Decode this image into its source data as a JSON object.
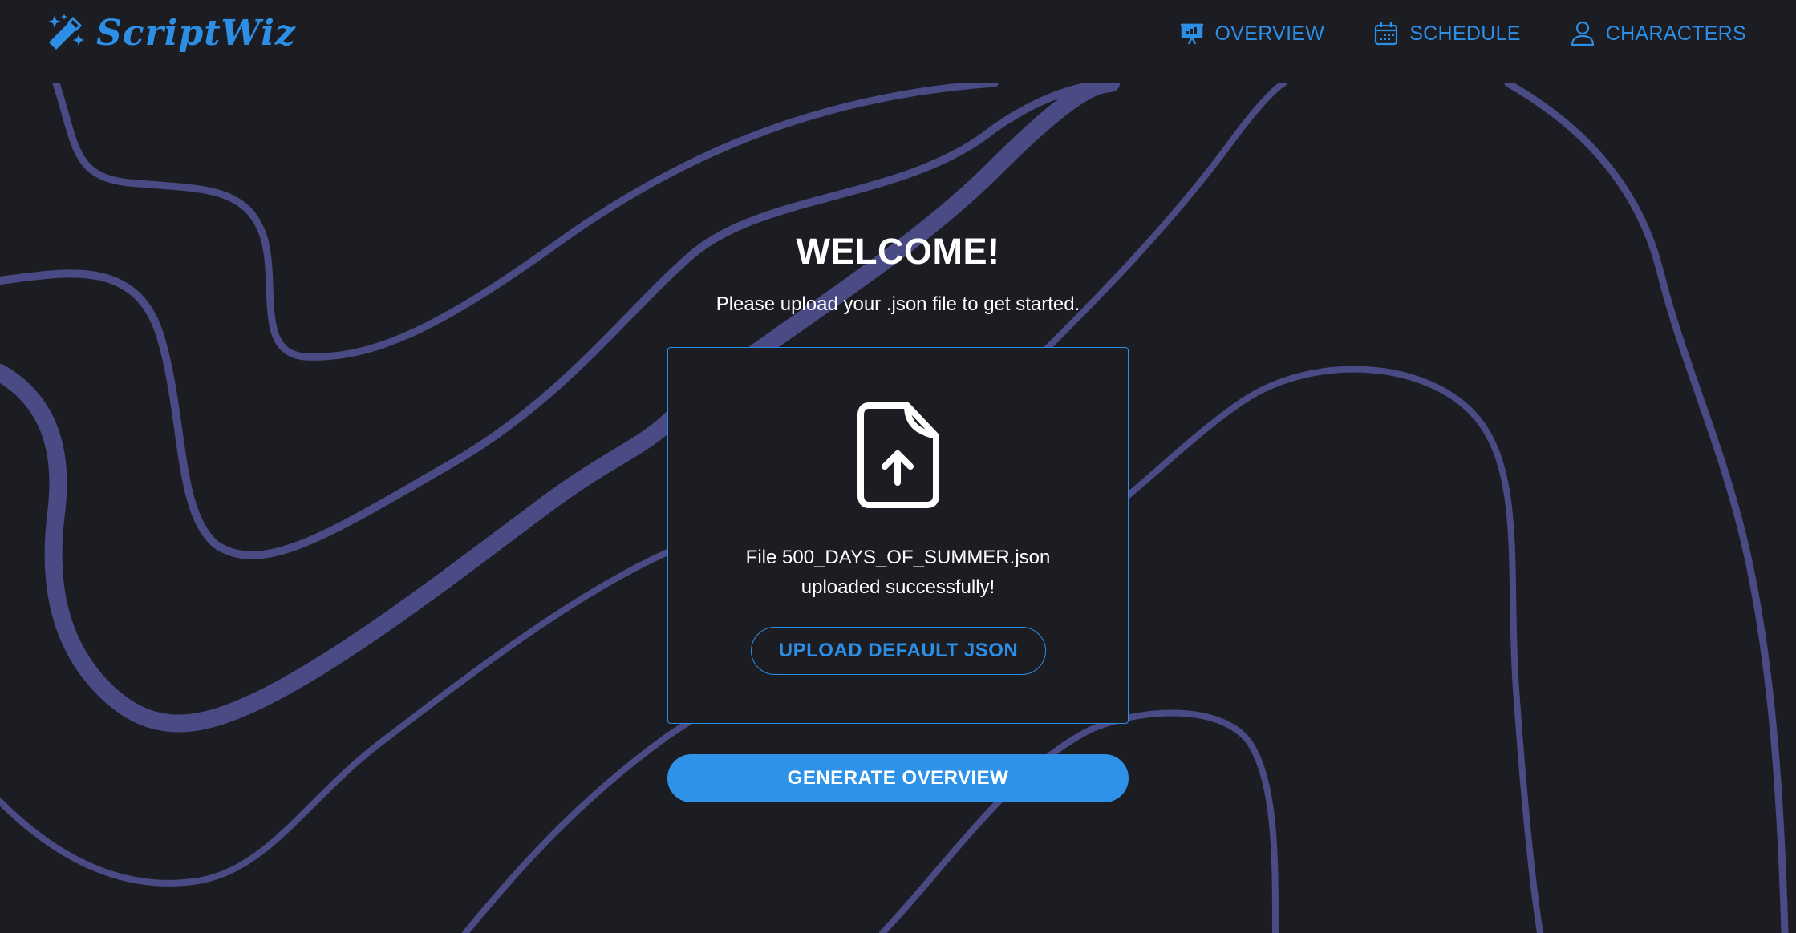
{
  "brand": {
    "name": "ScriptWiz",
    "icon": "magic-wand-icon"
  },
  "nav": {
    "items": [
      {
        "label": "OVERVIEW",
        "icon": "presentation-chart-icon"
      },
      {
        "label": "SCHEDULE",
        "icon": "calendar-icon"
      },
      {
        "label": "CHARACTERS",
        "icon": "user-icon"
      }
    ]
  },
  "main": {
    "title": "WELCOME!",
    "subtitle": "Please upload your .json file to get started.",
    "upload": {
      "icon": "file-upload-icon",
      "status_line1": "File 500_DAYS_OF_SUMMER.json",
      "status_line2": "uploaded successfully!",
      "default_button": "UPLOAD DEFAULT JSON"
    },
    "generate_button": "GENERATE OVERVIEW"
  },
  "colors": {
    "background": "#1c1d22",
    "accent": "#2d8ee6",
    "wave": "#4a4a84",
    "text": "#ffffff"
  }
}
